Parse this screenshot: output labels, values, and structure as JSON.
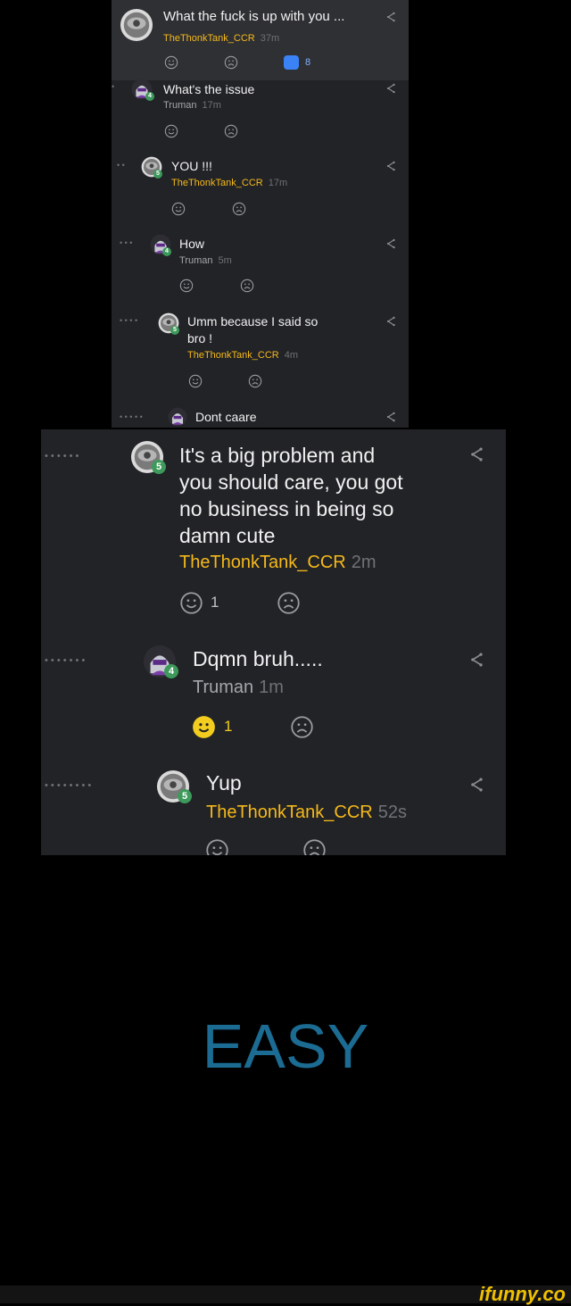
{
  "small_thread": {
    "top": {
      "message": "What the fuck is up with you ...",
      "user": "TheThonkTank_CCR",
      "time": "37m",
      "replies_badge": "8"
    },
    "replies": [
      {
        "dots": "•",
        "message": "What's the issue",
        "user": "Truman",
        "time": "17m",
        "level": "4"
      },
      {
        "dots": "• •",
        "message": "YOU !!!",
        "user": "TheThonkTank_CCR",
        "time": "17m",
        "level": "5"
      },
      {
        "dots": "• • •",
        "message": "How",
        "user": "Truman",
        "time": "5m",
        "level": "4"
      },
      {
        "dots": "• • • •",
        "message_line1": "Umm because I said so",
        "message_line2": "bro !",
        "user": "TheThonkTank_CCR",
        "time": "4m",
        "level": "5"
      },
      {
        "dots": "• • • • •",
        "message": "Dont caare"
      }
    ]
  },
  "big_thread": {
    "replies": [
      {
        "dots": "• • • • • •",
        "lines": [
          "It's a big problem and",
          "you should care, you got",
          "no business in being so",
          "damn cute"
        ],
        "user": "TheThonkTank_CCR",
        "time": "2m",
        "level": "5",
        "smile_count": "1"
      },
      {
        "dots": "• • • • • • •",
        "message": "Dqmn bruh.....",
        "user": "Truman",
        "time": "1m",
        "level": "4",
        "smile_count": "1"
      },
      {
        "dots": "• • • • • • • •",
        "message": "Yup",
        "user": "TheThonkTank_CCR",
        "time": "52s",
        "level": "5"
      }
    ]
  },
  "caption": "EASY",
  "watermark": "ifunny.co",
  "colors": {
    "panel": "#222327",
    "username_ccr": "#f5b91a",
    "caption": "#1b6b92",
    "level_badge": "#3d9a5b",
    "smile_active": "#f2cc1e",
    "reply_badge": "#3b82f6"
  }
}
